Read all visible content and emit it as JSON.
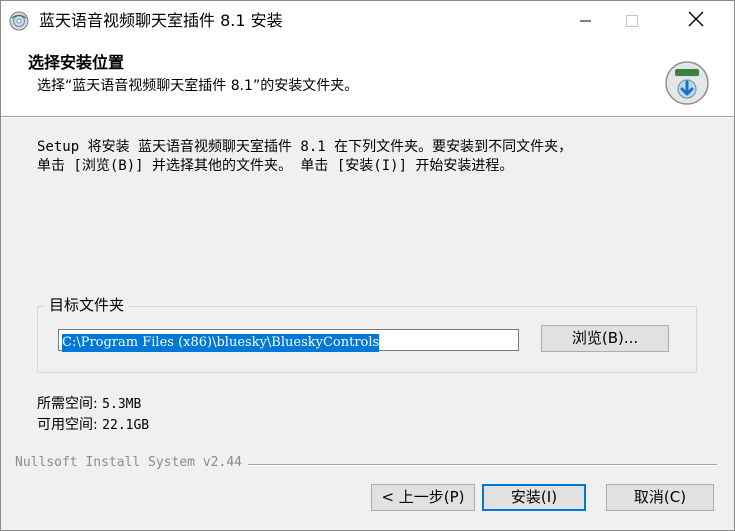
{
  "window": {
    "title": "蓝天语音视频聊天室插件 8.1 安装",
    "app_icon": "installer-disc-icon"
  },
  "header": {
    "title": "选择安装位置",
    "subtitle": "选择“蓝天语音视频聊天室插件 8.1”的安装文件夹。",
    "icon": "install-disk-icon"
  },
  "body": {
    "intro_line1": "Setup 将安装 蓝天语音视频聊天室插件 8.1 在下列文件夹。要安装到不同文件夹，",
    "intro_line2": "单击 [浏览(B)] 并选择其他的文件夹。 单击 [安装(I)] 开始安装进程。"
  },
  "destination": {
    "group_label": "目标文件夹",
    "path_value": "C:\\Program Files (x86)\\bluesky\\BlueskyControls",
    "browse_label": "浏览(B)..."
  },
  "space": {
    "required_label": "所需空间:",
    "required_value": "5.3MB",
    "available_label": "可用空间:",
    "available_value": "22.1GB"
  },
  "branding": "Nullsoft Install System v2.44",
  "buttons": {
    "back_label": "< 上一步(P)",
    "install_label": "安装(I)",
    "cancel_label": "取消(C)"
  },
  "colors": {
    "accent": "#0078d7",
    "window_bg": "#f0f0f0"
  }
}
